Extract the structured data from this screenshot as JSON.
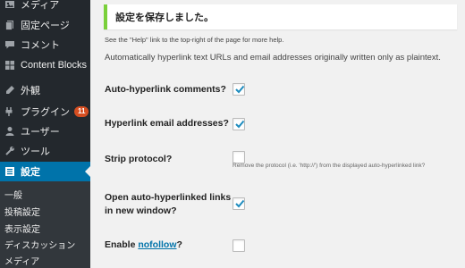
{
  "sidebar": {
    "items": [
      {
        "label": "メディア",
        "icon": "media-icon"
      },
      {
        "label": "固定ページ",
        "icon": "pages-icon"
      },
      {
        "label": "コメント",
        "icon": "comments-icon"
      },
      {
        "label": "Content Blocks",
        "icon": "content-blocks-icon"
      },
      {
        "label": "外観",
        "icon": "appearance-icon"
      },
      {
        "label": "プラグイン",
        "icon": "plugins-icon",
        "badge": "11"
      },
      {
        "label": "ユーザー",
        "icon": "users-icon"
      },
      {
        "label": "ツール",
        "icon": "tools-icon"
      },
      {
        "label": "設定",
        "icon": "settings-icon",
        "current": true
      }
    ],
    "submenu": [
      {
        "label": "一般"
      },
      {
        "label": "投稿設定"
      },
      {
        "label": "表示設定"
      },
      {
        "label": "ディスカッション"
      },
      {
        "label": "メディア"
      }
    ]
  },
  "notice": {
    "text": "設定を保存しました。"
  },
  "main": {
    "help_text": "See the \"Help\" link to the top-right of the page for more help.",
    "intro": "Automatically hyperlink text URLs and email addresses originally written only as plaintext.",
    "options": [
      {
        "label": "Auto-hyperlink comments?",
        "checked": true
      },
      {
        "label": "Hyperlink email addresses?",
        "checked": true
      },
      {
        "label": "Strip protocol?",
        "checked": false,
        "description": "Remove the protocol (i.e. 'http://') from the displayed auto-hyperlinked link?"
      },
      {
        "label_line1": "Open auto-hyperlinked links",
        "label_line2": "in new window?",
        "checked": true
      },
      {
        "label_prefix": "Enable ",
        "label_link": "nofollow",
        "label_suffix": "?",
        "checked": false
      }
    ]
  },
  "colors": {
    "sidebar_bg": "#23282d",
    "submenu_bg": "#32373c",
    "current_bg": "#0073aa",
    "badge_bg": "#d54e21",
    "notice_border": "#7ad03a",
    "check_color": "#1e8cbe",
    "link_color": "#0073aa"
  }
}
